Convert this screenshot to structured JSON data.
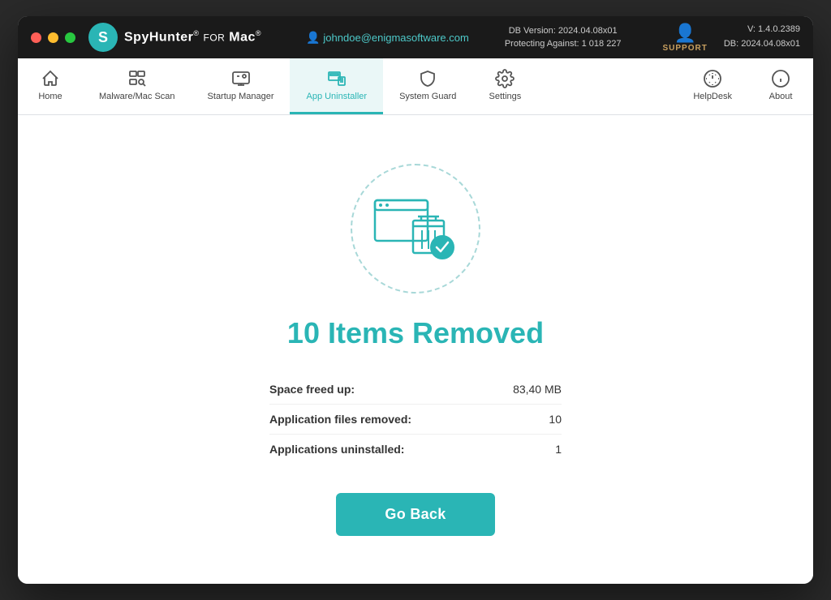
{
  "window": {
    "title": "SpyHunter for Mac"
  },
  "titlebar": {
    "user_email": "johndoe@enigmasoftware.com",
    "db_version": "DB Version: 2024.04.08x01",
    "protecting": "Protecting Against: 1 018 227",
    "support_label": "SUPPORT",
    "version": "V: 1.4.0.2389",
    "db_short": "DB:  2024.04.08x01"
  },
  "nav": {
    "items": [
      {
        "id": "home",
        "label": "Home",
        "active": false
      },
      {
        "id": "malware",
        "label": "Malware/Mac Scan",
        "active": false
      },
      {
        "id": "startup",
        "label": "Startup Manager",
        "active": false
      },
      {
        "id": "uninstaller",
        "label": "App Uninstaller",
        "active": true
      },
      {
        "id": "systemguard",
        "label": "System Guard",
        "active": false
      },
      {
        "id": "settings",
        "label": "Settings",
        "active": false
      }
    ],
    "right_items": [
      {
        "id": "helpdesk",
        "label": "HelpDesk"
      },
      {
        "id": "about",
        "label": "About"
      }
    ]
  },
  "main": {
    "title": "10 Items Removed",
    "stats": [
      {
        "label": "Space freed up:",
        "value": "83,40 MB"
      },
      {
        "label": "Application files removed:",
        "value": "10"
      },
      {
        "label": "Applications uninstalled:",
        "value": "1"
      }
    ],
    "go_back_label": "Go Back"
  },
  "colors": {
    "teal": "#2ab5b5",
    "teal_light": "#a8d8d8",
    "gold": "#c8a060"
  }
}
